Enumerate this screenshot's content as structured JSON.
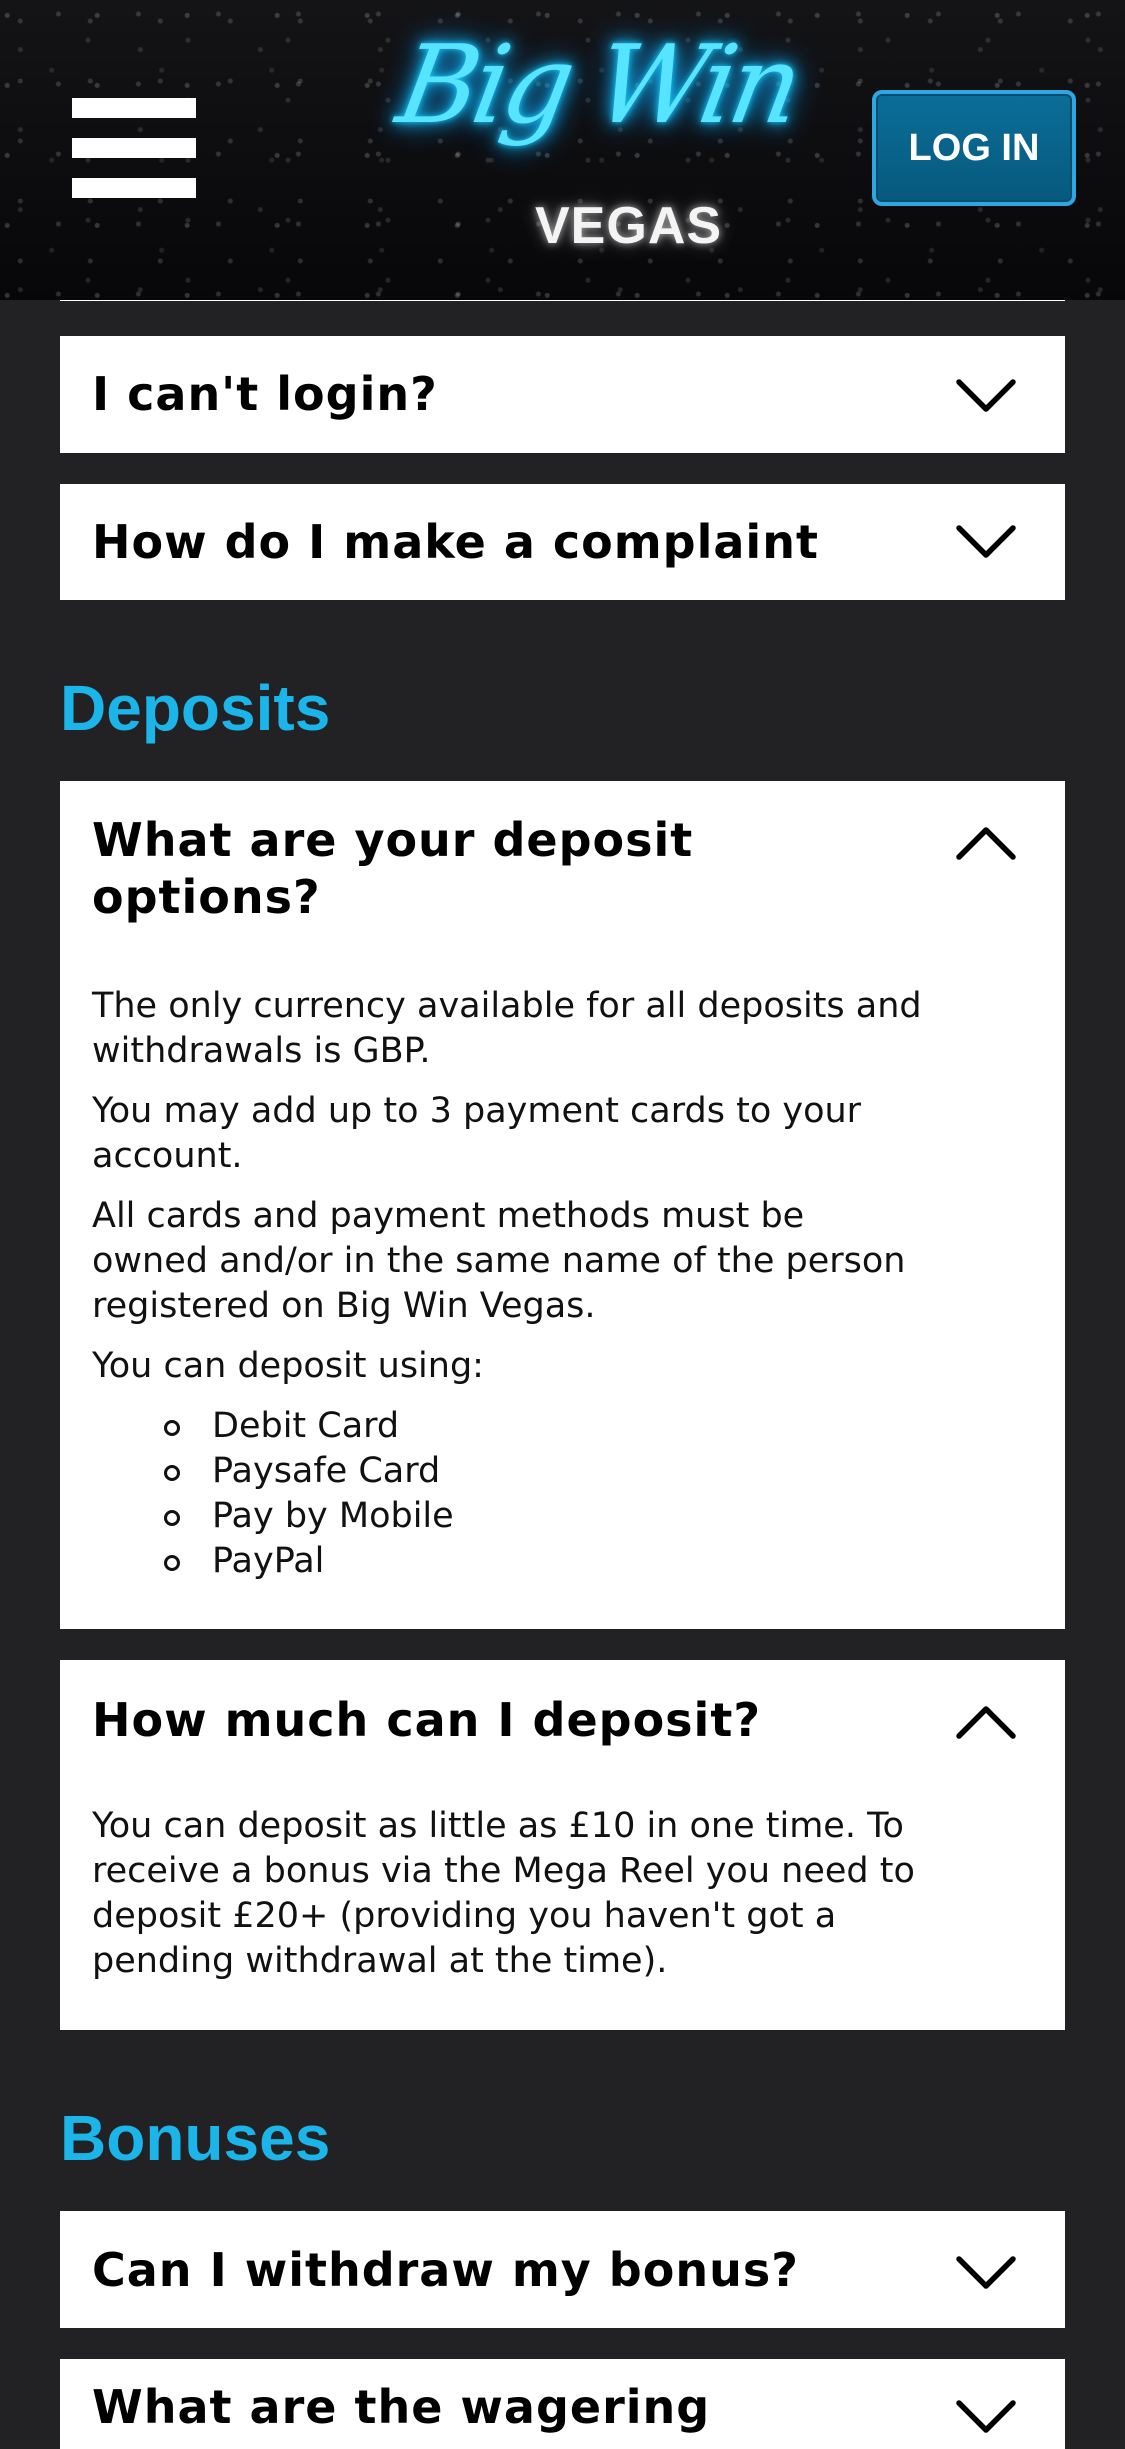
{
  "header": {
    "logo_script": "Big Win",
    "logo_sub": "VEGAS",
    "login_label": "LOG IN"
  },
  "faq": {
    "sections": [
      {
        "items": [
          {
            "question": "I can't login?"
          },
          {
            "question": "How do I make a complaint"
          }
        ]
      },
      {
        "title": "Deposits",
        "items": [
          {
            "question": "What are your deposit options?",
            "answer_paragraphs": [
              "The only currency available for all deposits and withdrawals is GBP.",
              "You may add up to 3 payment cards to your account.",
              "All cards and payment methods must be owned and/or in the same name of the person registered on Big Win Vegas.",
              "You can deposit using:"
            ],
            "answer_list": [
              "Debit Card",
              "Paysafe Card",
              "Pay by Mobile",
              "PayPal"
            ]
          },
          {
            "question": "How much can I deposit?",
            "answer_paragraphs": [
              "You can deposit as little as £10 in one time. To receive a bonus via the Mega Reel you need to deposit £20+ (providing you haven't got a pending withdrawal at the time)."
            ]
          }
        ]
      },
      {
        "title": "Bonuses",
        "items": [
          {
            "question": "Can I withdraw my bonus?"
          },
          {
            "question": "What are the wagering"
          }
        ]
      }
    ]
  }
}
